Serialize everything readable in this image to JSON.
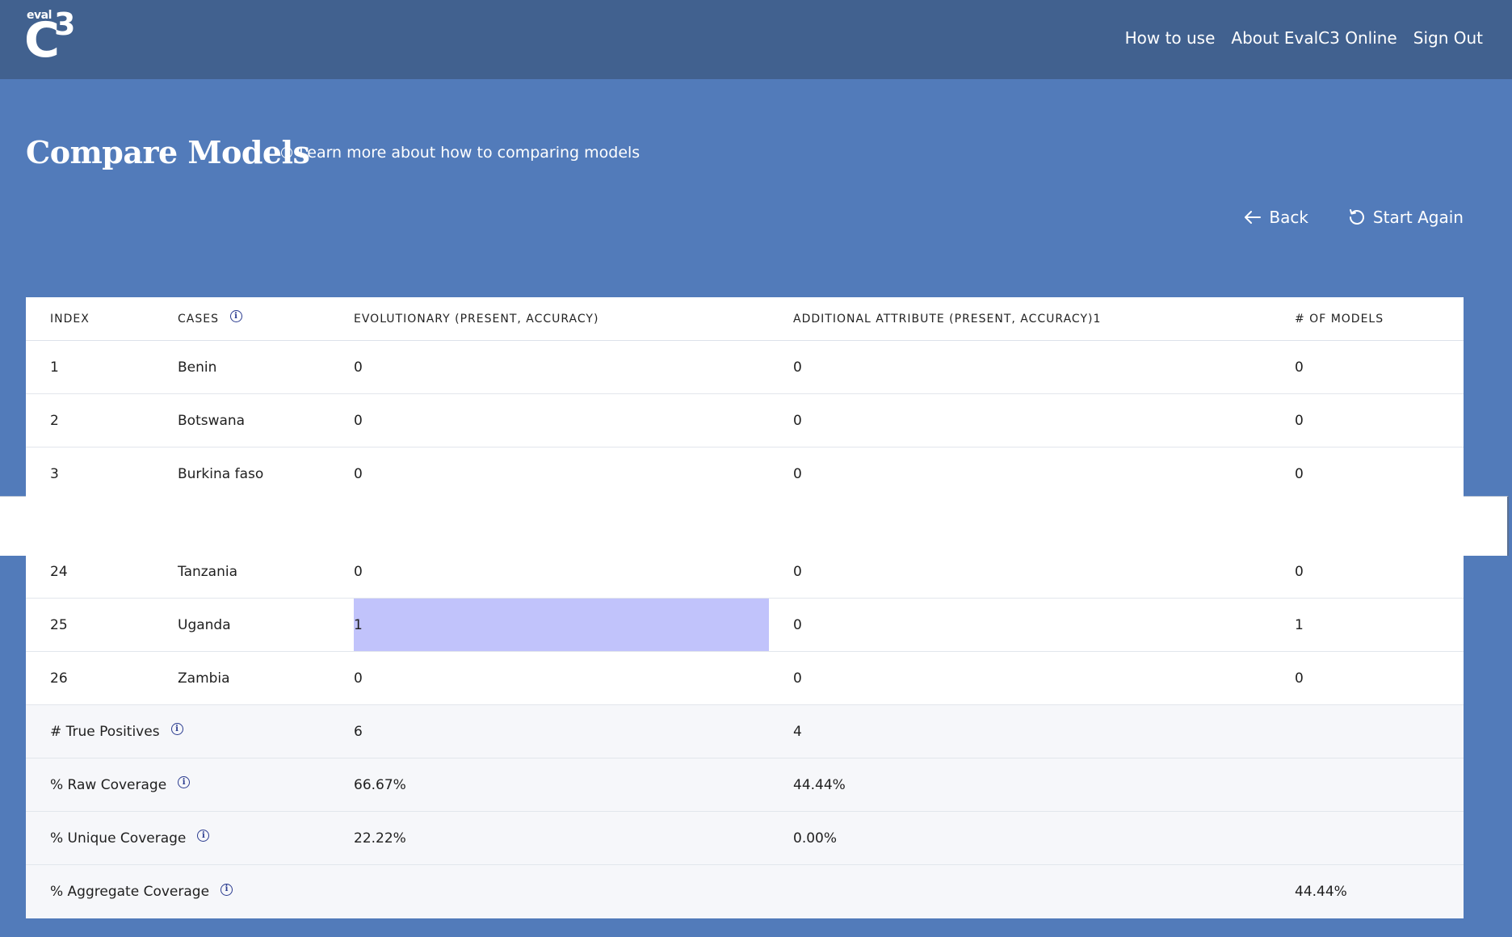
{
  "logo": {
    "top_text": "eval",
    "letter": "C",
    "superscript": "3"
  },
  "nav": {
    "items": [
      "How to use",
      "About EvalC3 Online",
      "Sign Out"
    ]
  },
  "header": {
    "title": "Compare Models",
    "learn_more": "Learn more about how to comparing models",
    "back_label": "Back",
    "start_again_label": "Start Again"
  },
  "table": {
    "columns": [
      "INDEX",
      "CASES",
      "EVOLUTIONARY (PRESENT, ACCURACY)",
      "ADDITIONAL ATTRIBUTE (PRESENT, ACCURACY)1",
      "# OF MODELS"
    ],
    "rows_top": [
      {
        "index": "1",
        "case": "Benin",
        "evo": "0",
        "add": "0",
        "models": "0"
      },
      {
        "index": "2",
        "case": "Botswana",
        "evo": "0",
        "add": "0",
        "models": "0"
      },
      {
        "index": "3",
        "case": "Burkina faso",
        "evo": "0",
        "add": "0",
        "models": "0"
      }
    ],
    "rows_bottom": [
      {
        "index": "24",
        "case": "Tanzania",
        "evo": "0",
        "add": "0",
        "models": "0"
      },
      {
        "index": "25",
        "case": "Uganda",
        "evo": "1",
        "add": "0",
        "models": "1"
      },
      {
        "index": "26",
        "case": "Zambia",
        "evo": "0",
        "add": "0",
        "models": "0"
      }
    ],
    "summary": [
      {
        "label": "# True Positives",
        "evo": "6",
        "add": "4",
        "models": ""
      },
      {
        "label": "% Raw Coverage",
        "evo": "66.67%",
        "add": "44.44%",
        "models": ""
      },
      {
        "label": "% Unique Coverage",
        "evo": "22.22%",
        "add": "0.00%",
        "models": ""
      },
      {
        "label": "% Aggregate Coverage",
        "evo": "",
        "add": "",
        "models": "44.44%"
      }
    ]
  },
  "colors": {
    "topbar": "#41618f",
    "background": "#527bba",
    "highlight_cell": "#c1c3fb"
  }
}
